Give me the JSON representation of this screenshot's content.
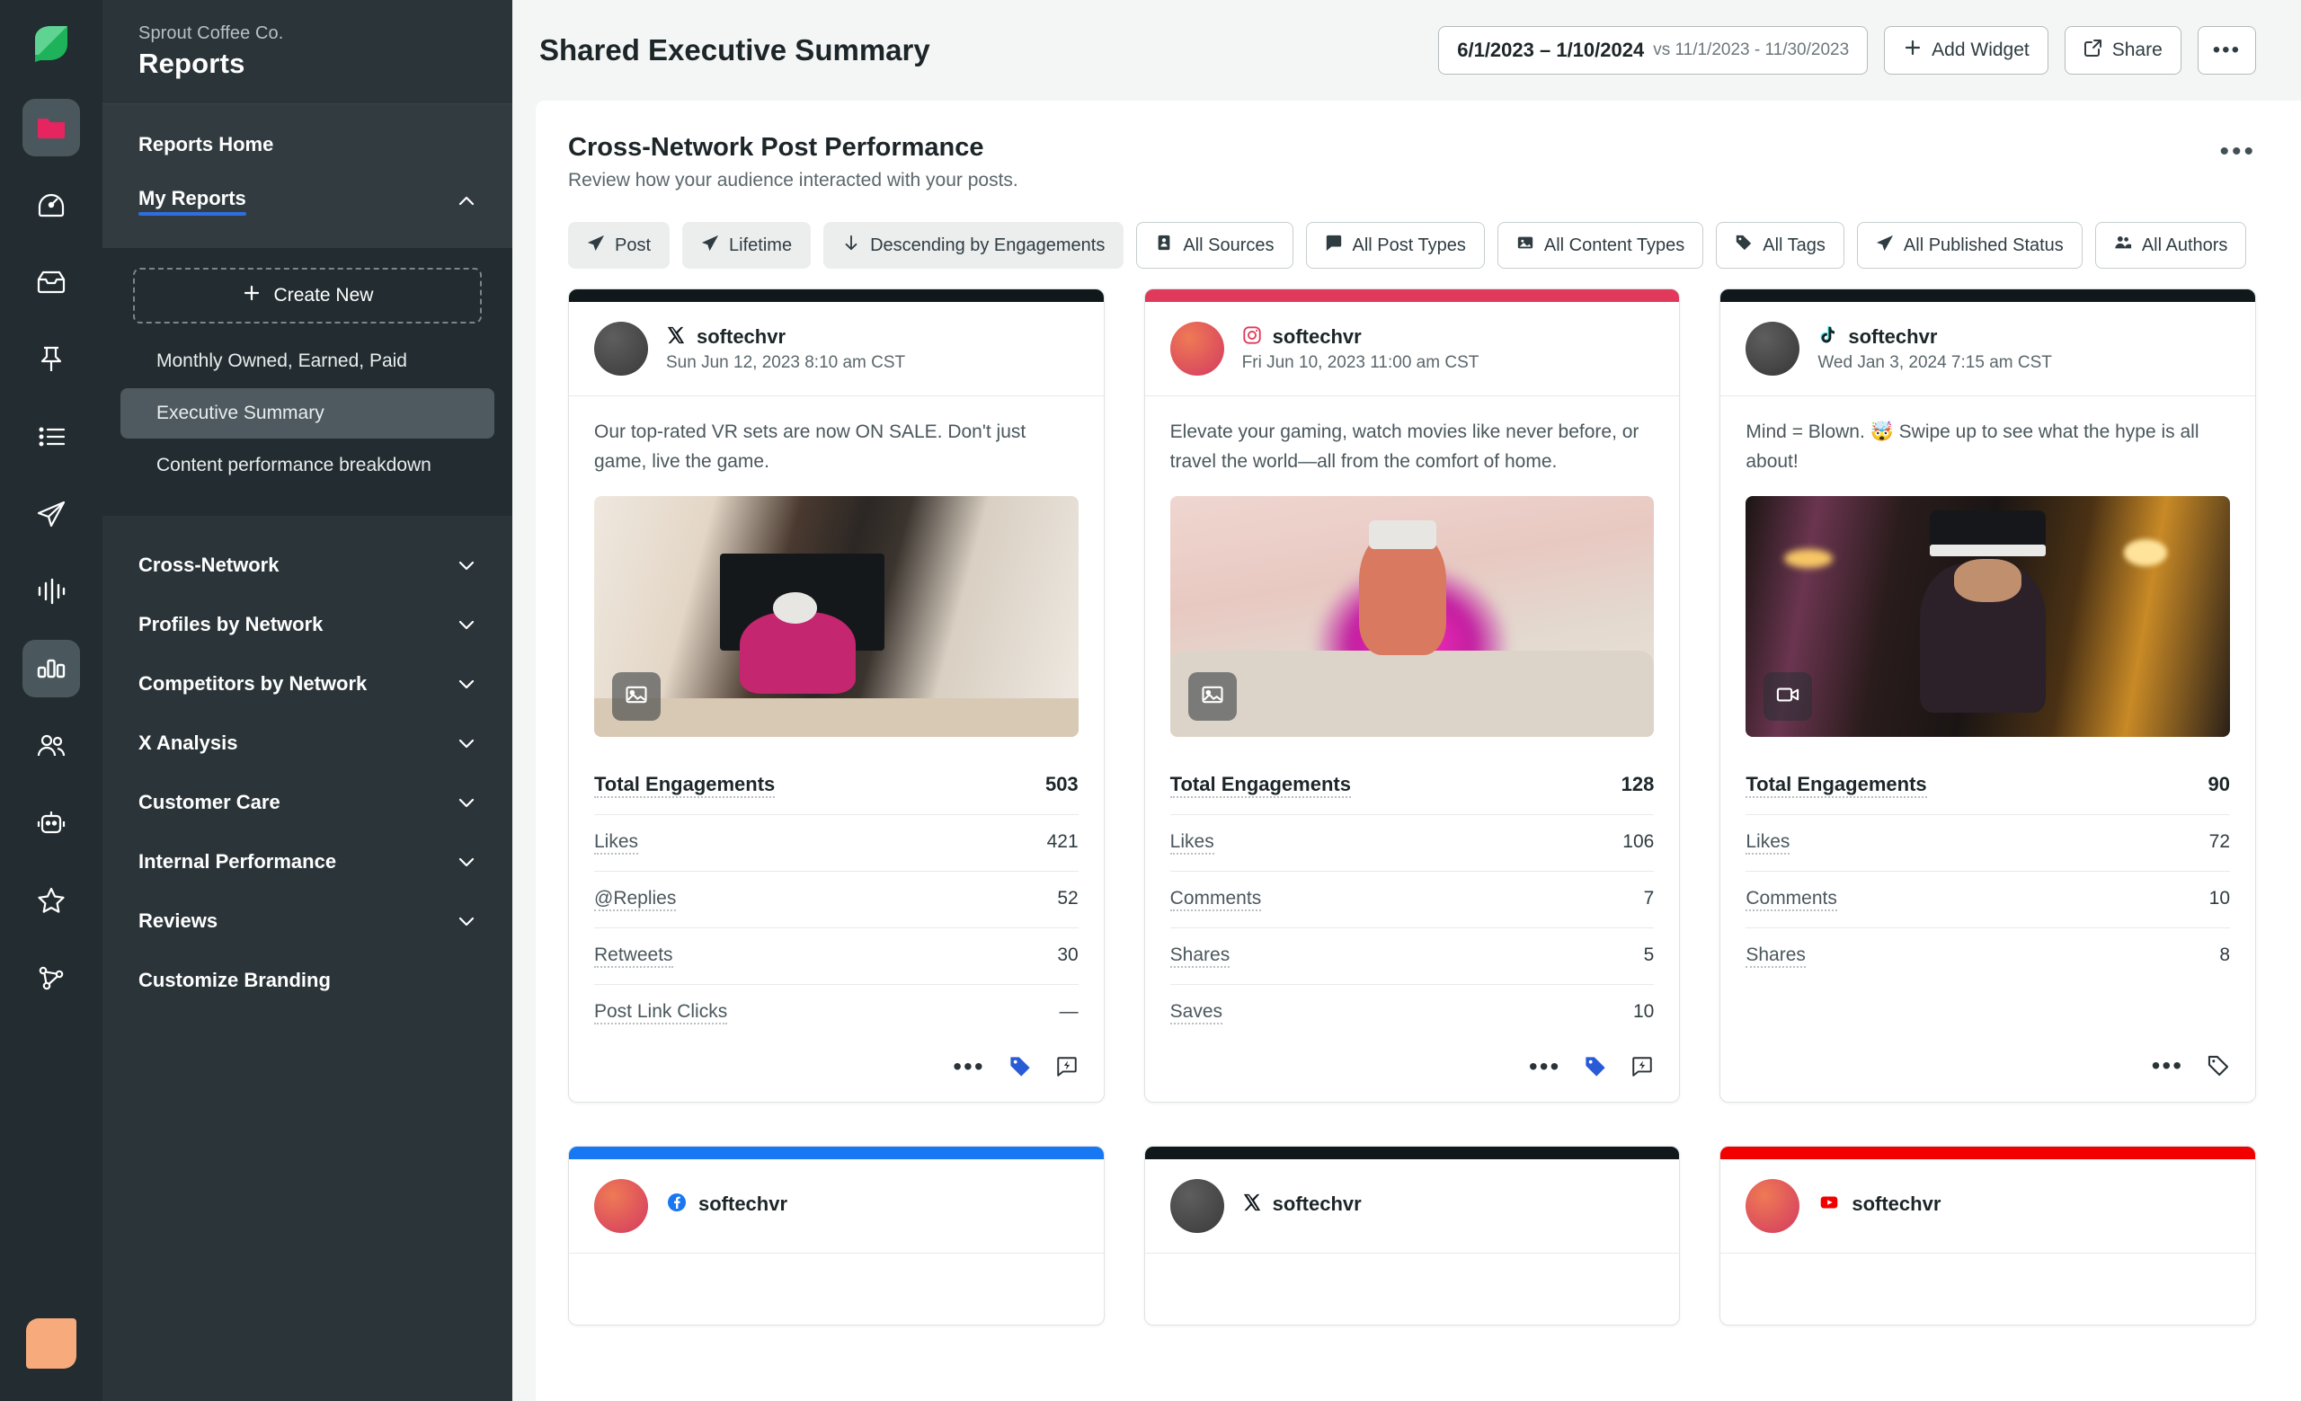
{
  "rail": {
    "logo": "sprout-leaf-logo",
    "items": [
      {
        "icon": "folder-icon",
        "name": "reports",
        "active": true
      },
      {
        "icon": "compass-icon",
        "name": "dashboard",
        "active": false
      },
      {
        "icon": "inbox-icon",
        "name": "inbox",
        "active": false
      },
      {
        "icon": "pin-icon",
        "name": "publishing",
        "active": false
      },
      {
        "icon": "list-icon",
        "name": "tasks",
        "active": false
      },
      {
        "icon": "paper-plane-icon",
        "name": "compose",
        "active": false
      },
      {
        "icon": "pulse-icon",
        "name": "listening",
        "active": false
      },
      {
        "icon": "bar-chart-icon",
        "name": "analytics",
        "active": true
      },
      {
        "icon": "people-icon",
        "name": "audience",
        "active": false
      },
      {
        "icon": "bot-icon",
        "name": "bots",
        "active": false
      },
      {
        "icon": "star-icon",
        "name": "reviews",
        "active": false
      },
      {
        "icon": "network-icon",
        "name": "integrations",
        "active": false
      }
    ],
    "avatar": "user-avatar"
  },
  "nav": {
    "org": "Sprout Coffee Co.",
    "title": "Reports",
    "reports_home": "Reports Home",
    "my_reports": "My Reports",
    "create_new": "Create New",
    "my_reports_items": [
      {
        "label": "Monthly Owned, Earned, Paid",
        "active": false
      },
      {
        "label": "Executive Summary",
        "active": true
      },
      {
        "label": "Content performance breakdown",
        "active": false
      }
    ],
    "groups": [
      {
        "label": "Cross-Network",
        "expandable": true
      },
      {
        "label": "Profiles by Network",
        "expandable": true
      },
      {
        "label": "Competitors by Network",
        "expandable": true
      },
      {
        "label": "X Analysis",
        "expandable": true
      },
      {
        "label": "Customer Care",
        "expandable": true
      },
      {
        "label": "Internal Performance",
        "expandable": true
      },
      {
        "label": "Reviews",
        "expandable": true
      },
      {
        "label": "Customize Branding",
        "expandable": false
      }
    ]
  },
  "topbar": {
    "page_title": "Shared Executive Summary",
    "date_range": "6/1/2023 – 1/10/2024",
    "date_compare": "vs 11/1/2023 - 11/30/2023",
    "add_widget": "Add Widget",
    "share": "Share",
    "more": "•••"
  },
  "widget": {
    "title": "Cross-Network Post Performance",
    "subtitle": "Review how your audience interacted with your posts.",
    "more": "•••",
    "filters": [
      {
        "label": "Post",
        "icon": "paper-plane-icon",
        "style": "filled"
      },
      {
        "label": "Lifetime",
        "icon": "paper-plane-icon",
        "style": "filled"
      },
      {
        "label": "Descending by Engagements",
        "icon": "arrow-down-icon",
        "style": "filled"
      },
      {
        "label": "All Sources",
        "icon": "profile-card-icon",
        "style": "outline"
      },
      {
        "label": "All Post Types",
        "icon": "message-icon",
        "style": "outline"
      },
      {
        "label": "All Content Types",
        "icon": "image-icon",
        "style": "outline"
      },
      {
        "label": "All Tags",
        "icon": "tag-icon",
        "style": "outline"
      },
      {
        "label": "All Published Status",
        "icon": "paper-plane-icon",
        "style": "outline"
      },
      {
        "label": "All Authors",
        "icon": "people-icon",
        "style": "outline"
      }
    ]
  },
  "posts": [
    {
      "network": "x",
      "network_icon": "x-icon",
      "bar_color": "#11181c",
      "avatar_colors": [
        "#595959",
        "#3c3c3c"
      ],
      "handle": "softechvr",
      "timestamp": "Sun Jun 12, 2023 8:10 am CST",
      "text": "Our top-rated VR sets are now ON SALE. Don't just game, live the game.",
      "media_badge": "image-icon",
      "media_scene": "living-room-vr",
      "metrics": [
        {
          "label": "Total Engagements",
          "value": "503",
          "total": true
        },
        {
          "label": "Likes",
          "value": "421",
          "total": false
        },
        {
          "label": "@Replies",
          "value": "52",
          "total": false
        },
        {
          "label": "Retweets",
          "value": "30",
          "total": false
        },
        {
          "label": "Post Link Clicks",
          "value": "—",
          "total": false
        }
      ],
      "actions": [
        "more-dots-icon",
        "tag-icon-filled",
        "boost-icon"
      ]
    },
    {
      "network": "instagram",
      "network_icon": "instagram-icon",
      "bar_color": "#e0395c",
      "avatar_colors": [
        "#e8654f",
        "#d8425e"
      ],
      "handle": "softechvr",
      "timestamp": "Fri Jun 10, 2023 11:00 am CST",
      "text": "Elevate your gaming, watch movies like never before, or travel the world—all from the comfort of home.",
      "media_badge": "image-icon",
      "media_scene": "pink-room-vr",
      "metrics": [
        {
          "label": "Total Engagements",
          "value": "128",
          "total": true
        },
        {
          "label": "Likes",
          "value": "106",
          "total": false
        },
        {
          "label": "Comments",
          "value": "7",
          "total": false
        },
        {
          "label": "Shares",
          "value": "5",
          "total": false
        },
        {
          "label": "Saves",
          "value": "10",
          "total": false
        }
      ],
      "actions": [
        "more-dots-icon",
        "tag-icon-filled",
        "boost-icon"
      ]
    },
    {
      "network": "tiktok",
      "network_icon": "tiktok-icon",
      "bar_color": "#11181c",
      "avatar_colors": [
        "#5a5a5a",
        "#3a3a3a"
      ],
      "handle": "softechvr",
      "timestamp": "Wed Jan 3, 2024 7:15 am CST",
      "text": "Mind = Blown. 🤯 Swipe up to see what the hype is all about!",
      "media_badge": "video-icon",
      "media_scene": "night-bar-vr",
      "metrics": [
        {
          "label": "Total Engagements",
          "value": "90",
          "total": true
        },
        {
          "label": "Likes",
          "value": "72",
          "total": false
        },
        {
          "label": "Comments",
          "value": "10",
          "total": false
        },
        {
          "label": "Shares",
          "value": "8",
          "total": false
        }
      ],
      "actions": [
        "more-dots-icon",
        "tag-icon-outline"
      ]
    }
  ],
  "posts_row2": [
    {
      "network": "facebook",
      "network_icon": "facebook-icon",
      "bar_color": "#1877f2",
      "avatar_colors": [
        "#e8654f",
        "#d8425e"
      ],
      "handle": "softechvr"
    },
    {
      "network": "x",
      "network_icon": "x-icon",
      "bar_color": "#11181c",
      "avatar_colors": [
        "#595959",
        "#3c3c3c"
      ],
      "handle": "softechvr"
    },
    {
      "network": "youtube",
      "network_icon": "youtube-icon",
      "bar_color": "#f20000",
      "avatar_colors": [
        "#e8654f",
        "#d8425e"
      ],
      "handle": "softechvr"
    }
  ],
  "colors": {
    "rail_bg": "#232d31",
    "nav_bg": "#2b3539",
    "accent_blue": "#2f6fdd",
    "canvas_bg": "#f4f5f5",
    "folder_pink": "#e6245f"
  }
}
